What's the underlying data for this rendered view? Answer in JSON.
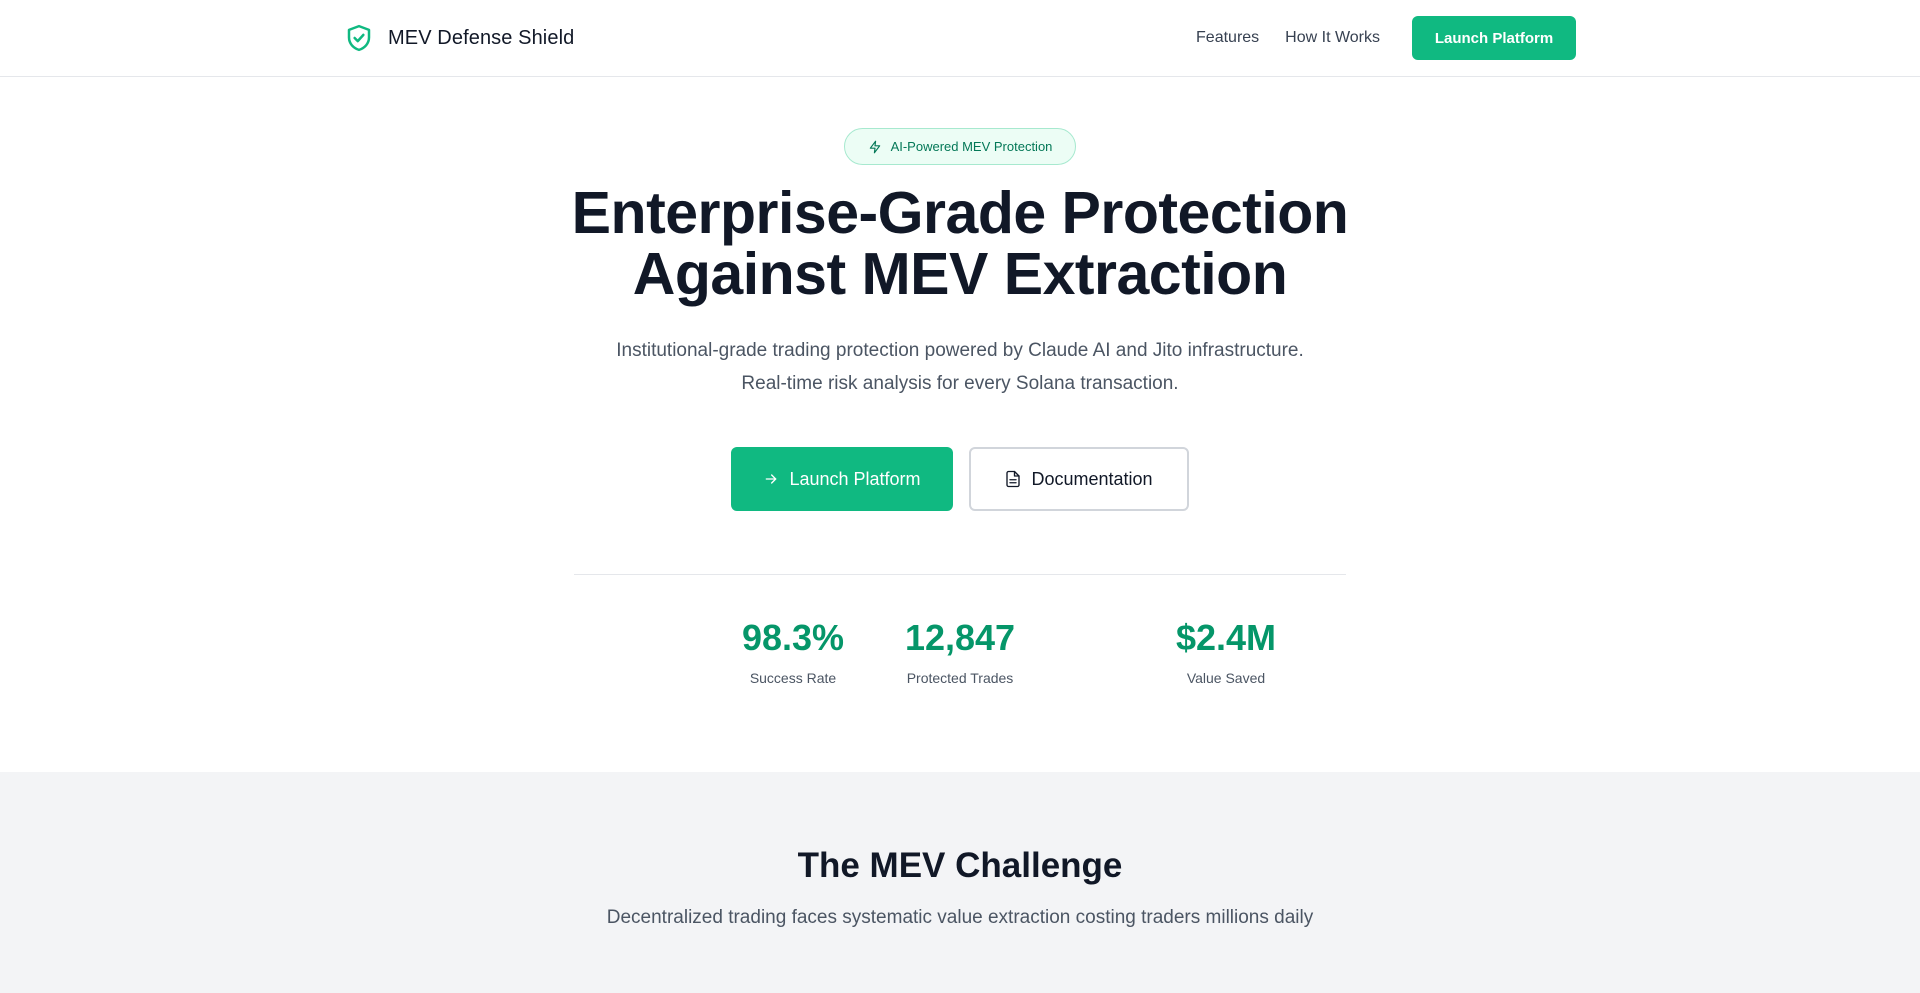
{
  "header": {
    "brand_name": "MEV Defense Shield",
    "brand_icon": "shield-check-icon",
    "nav": {
      "features": "Features",
      "how_it_works": "How It Works",
      "launch": "Launch Platform"
    }
  },
  "hero": {
    "badge": "AI-Powered MEV Protection",
    "badge_icon": "lightning-icon",
    "title_line1": "Enterprise-Grade Protection",
    "title_line2": "Against MEV Extraction",
    "subtitle_line1": "Institutional-grade trading protection powered by Claude AI and Jito infrastructure.",
    "subtitle_line2": "Real-time risk analysis for every Solana transaction.",
    "primary_cta": "Launch Platform",
    "primary_cta_icon": "arrow-right-icon",
    "secondary_cta": "Documentation",
    "secondary_cta_icon": "document-icon"
  },
  "stats": [
    {
      "value": "98.3%",
      "label": "Success Rate"
    },
    {
      "value": "12,847",
      "label": "Protected Trades"
    },
    {
      "value": "$2.4M",
      "label": "Value Saved"
    }
  ],
  "challenge": {
    "title": "The MEV Challenge",
    "subtitle": "Decentralized trading faces systematic value extraction costing traders millions daily"
  },
  "colors": {
    "accent": "#10b981",
    "accent_dark": "#059669",
    "text": "#111827",
    "muted": "#4b5563",
    "section_bg": "#f3f4f6"
  }
}
